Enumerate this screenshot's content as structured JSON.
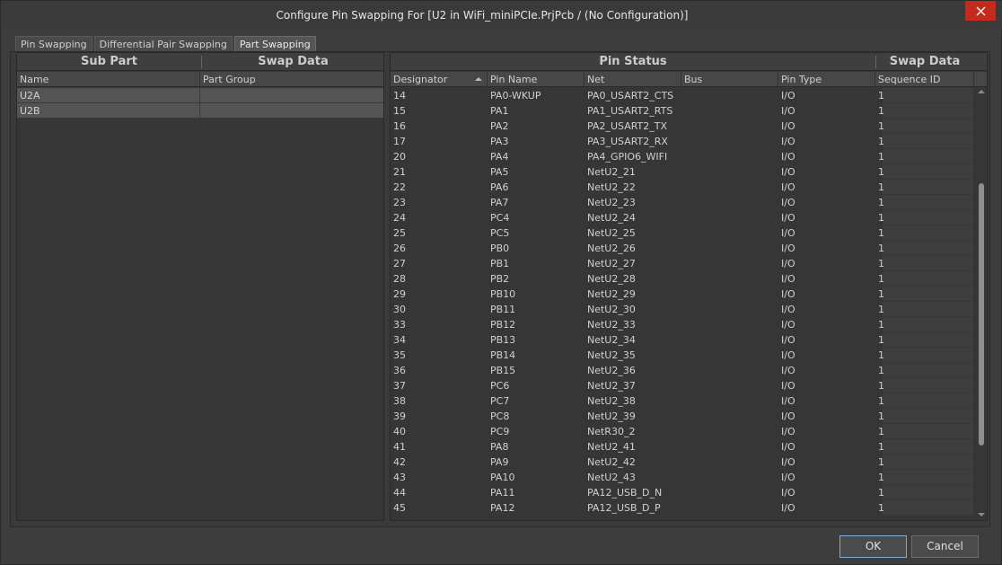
{
  "window": {
    "title": "Configure Pin Swapping For [U2 in WiFi_miniPCIe.PrjPcb / (No Configuration)]"
  },
  "tabs": [
    {
      "label": "Pin Swapping"
    },
    {
      "label": "Differential Pair Swapping"
    },
    {
      "label": "Part Swapping"
    }
  ],
  "left": {
    "header_subpart": "Sub Part",
    "header_swapdata": "Swap Data",
    "col_name": "Name",
    "col_group": "Part Group",
    "rows": [
      {
        "name": "U2A",
        "group": ""
      },
      {
        "name": "U2B",
        "group": ""
      }
    ]
  },
  "right": {
    "header_pinstatus": "Pin Status",
    "header_swapdata": "Swap Data",
    "columns": [
      "Designator",
      "Pin Name",
      "Net",
      "Bus",
      "Pin Type",
      "Sequence ID"
    ],
    "rows": [
      [
        "14",
        "PA0-WKUP",
        "PA0_USART2_CTS",
        "",
        "I/O",
        "1"
      ],
      [
        "15",
        "PA1",
        "PA1_USART2_RTS",
        "",
        "I/O",
        "1"
      ],
      [
        "16",
        "PA2",
        "PA2_USART2_TX",
        "",
        "I/O",
        "1"
      ],
      [
        "17",
        "PA3",
        "PA3_USART2_RX",
        "",
        "I/O",
        "1"
      ],
      [
        "20",
        "PA4",
        "PA4_GPIO6_WIFI",
        "",
        "I/O",
        "1"
      ],
      [
        "21",
        "PA5",
        "NetU2_21",
        "",
        "I/O",
        "1"
      ],
      [
        "22",
        "PA6",
        "NetU2_22",
        "",
        "I/O",
        "1"
      ],
      [
        "23",
        "PA7",
        "NetU2_23",
        "",
        "I/O",
        "1"
      ],
      [
        "24",
        "PC4",
        "NetU2_24",
        "",
        "I/O",
        "1"
      ],
      [
        "25",
        "PC5",
        "NetU2_25",
        "",
        "I/O",
        "1"
      ],
      [
        "26",
        "PB0",
        "NetU2_26",
        "",
        "I/O",
        "1"
      ],
      [
        "27",
        "PB1",
        "NetU2_27",
        "",
        "I/O",
        "1"
      ],
      [
        "28",
        "PB2",
        "NetU2_28",
        "",
        "I/O",
        "1"
      ],
      [
        "29",
        "PB10",
        "NetU2_29",
        "",
        "I/O",
        "1"
      ],
      [
        "30",
        "PB11",
        "NetU2_30",
        "",
        "I/O",
        "1"
      ],
      [
        "33",
        "PB12",
        "NetU2_33",
        "",
        "I/O",
        "1"
      ],
      [
        "34",
        "PB13",
        "NetU2_34",
        "",
        "I/O",
        "1"
      ],
      [
        "35",
        "PB14",
        "NetU2_35",
        "",
        "I/O",
        "1"
      ],
      [
        "36",
        "PB15",
        "NetU2_36",
        "",
        "I/O",
        "1"
      ],
      [
        "37",
        "PC6",
        "NetU2_37",
        "",
        "I/O",
        "1"
      ],
      [
        "38",
        "PC7",
        "NetU2_38",
        "",
        "I/O",
        "1"
      ],
      [
        "39",
        "PC8",
        "NetU2_39",
        "",
        "I/O",
        "1"
      ],
      [
        "40",
        "PC9",
        "NetR30_2",
        "",
        "I/O",
        "1"
      ],
      [
        "41",
        "PA8",
        "NetU2_41",
        "",
        "I/O",
        "1"
      ],
      [
        "42",
        "PA9",
        "NetU2_42",
        "",
        "I/O",
        "1"
      ],
      [
        "43",
        "PA10",
        "NetU2_43",
        "",
        "I/O",
        "1"
      ],
      [
        "44",
        "PA11",
        "PA12_USB_D_N",
        "",
        "I/O",
        "1"
      ],
      [
        "45",
        "PA12",
        "PA12_USB_D_P",
        "",
        "I/O",
        "1"
      ]
    ]
  },
  "buttons": {
    "ok": "OK",
    "cancel": "Cancel"
  }
}
